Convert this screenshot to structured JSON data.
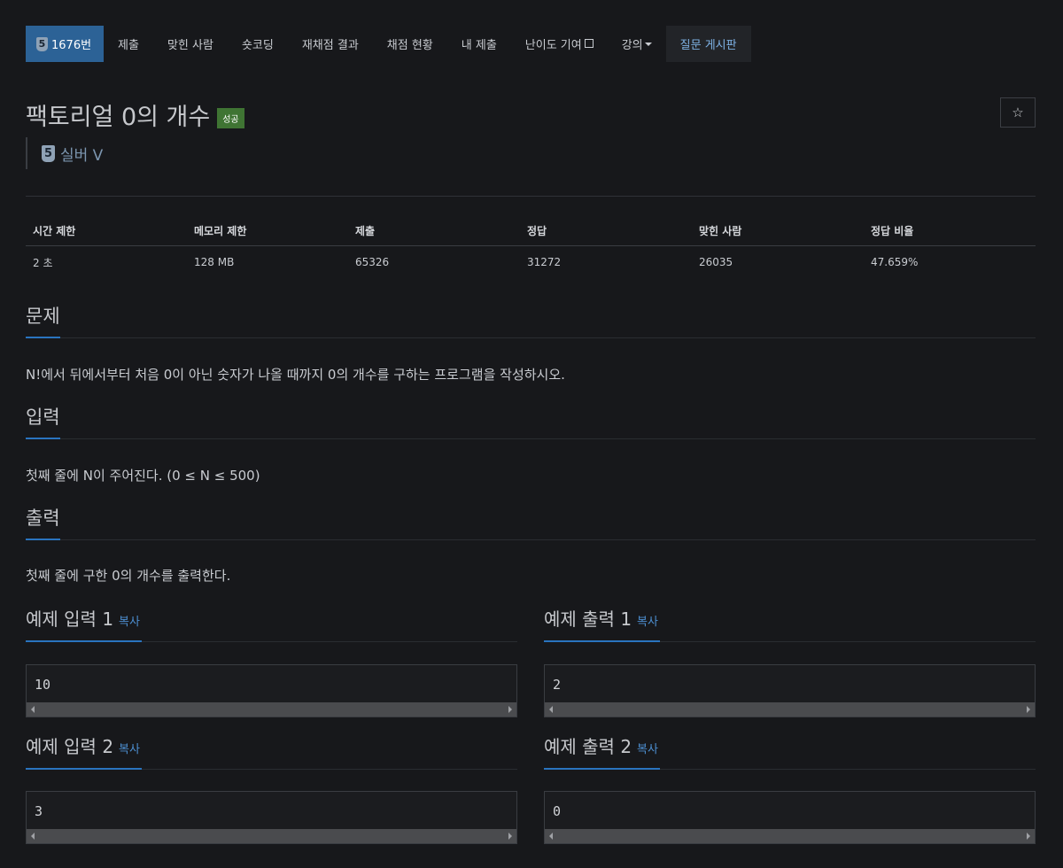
{
  "nav": {
    "problem_badge": "5",
    "problem_number": "1676번",
    "items": [
      "제출",
      "맞힌 사람",
      "숏코딩",
      "재채점 결과",
      "채점 현황",
      "내 제출",
      "난이도 기여",
      "강의"
    ],
    "qna": "질문 게시판"
  },
  "problem": {
    "title": "팩토리얼 0의 개수",
    "status": "성공",
    "tier_number": "5",
    "tier_label": "실버 V"
  },
  "info": {
    "headers": [
      "시간 제한",
      "메모리 제한",
      "제출",
      "정답",
      "맞힌 사람",
      "정답 비율"
    ],
    "values": [
      "2 초",
      "128 MB",
      "65326",
      "31272",
      "26035",
      "47.659%"
    ]
  },
  "sections": {
    "description": {
      "heading": "문제",
      "body": "N!에서 뒤에서부터 처음 0이 아닌 숫자가 나올 때까지 0의 개수를 구하는 프로그램을 작성하시오."
    },
    "input": {
      "heading": "입력",
      "body": "첫째 줄에 N이 주어진다. (0 ≤ N ≤ 500)"
    },
    "output": {
      "heading": "출력",
      "body": "첫째 줄에 구한 0의 개수를 출력한다."
    }
  },
  "samples": {
    "copy_label": "복사",
    "in1": {
      "heading": "예제 입력 1",
      "value": "10"
    },
    "out1": {
      "heading": "예제 출력 1",
      "value": "2"
    },
    "in2": {
      "heading": "예제 입력 2",
      "value": "3"
    },
    "out2": {
      "heading": "예제 출력 2",
      "value": "0"
    }
  },
  "colors": {
    "accent": "#2c6296",
    "success": "#3f7433",
    "link": "#4c8ed0"
  }
}
